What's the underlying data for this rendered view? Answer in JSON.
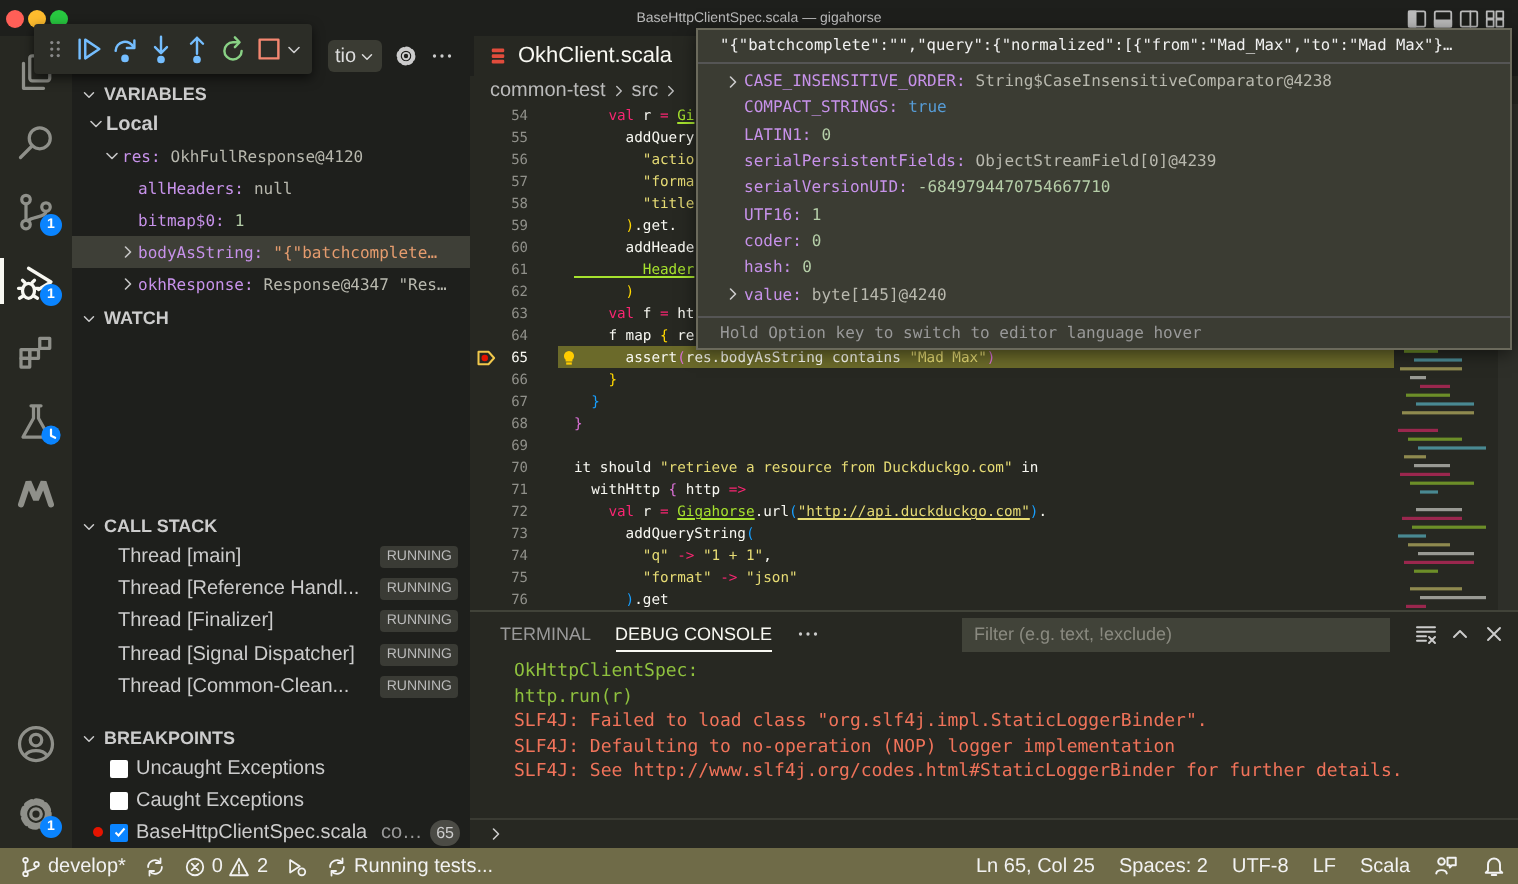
{
  "window": {
    "title": "BaseHttpClientSpec.scala — gigahorse"
  },
  "activity_bar": {
    "items": [
      {
        "kind": "explorer",
        "selected": false
      },
      {
        "kind": "search",
        "selected": false
      },
      {
        "kind": "source_control",
        "selected": false,
        "badge": "1"
      },
      {
        "kind": "run_debug",
        "selected": true,
        "badge": "1"
      },
      {
        "kind": "extensions",
        "selected": false
      },
      {
        "kind": "testing",
        "selected": false
      },
      {
        "kind": "metals",
        "selected": false
      }
    ],
    "bottom": [
      {
        "kind": "account"
      },
      {
        "kind": "settings",
        "badge": "1"
      }
    ]
  },
  "debug_toolbar": {
    "buttons": [
      {
        "kind": "continue"
      },
      {
        "kind": "step_over"
      },
      {
        "kind": "step_into"
      },
      {
        "kind": "step_out"
      },
      {
        "kind": "restart"
      },
      {
        "kind": "stop"
      }
    ]
  },
  "sidebar": {
    "run_config": "tio",
    "sections": [
      {
        "kind": "variables",
        "title": "VARIABLES",
        "expanded": true,
        "children": [
          {
            "label": "Local",
            "expanded": true,
            "selected": false,
            "children": [
              {
                "name": "res:",
                "value": "OkhFullResponse@4120",
                "kind": "object",
                "expanded": true,
                "selected": false,
                "children": [
                  {
                    "name": "allHeaders:",
                    "value": "null",
                    "kind": "null",
                    "selected": false
                  },
                  {
                    "name": "bitmap$0:",
                    "value": "1",
                    "kind": "number",
                    "selected": false
                  },
                  {
                    "name": "bodyAsString:",
                    "value": "\"{\"batchcomplete…",
                    "kind": "string",
                    "expanded": false,
                    "selected": true
                  },
                  {
                    "name": "okhResponse:",
                    "value": "Response@4347 \"Res…",
                    "kind": "object",
                    "expanded": false,
                    "selected": false
                  }
                ]
              }
            ]
          }
        ]
      },
      {
        "kind": "watch",
        "title": "WATCH",
        "expanded": true
      },
      {
        "kind": "call_stack",
        "title": "CALL STACK",
        "expanded": true,
        "threads": [
          {
            "name": "Thread [main]",
            "status": "RUNNING"
          },
          {
            "name": "Thread [Reference Handl...",
            "status": "RUNNING"
          },
          {
            "name": "Thread [Finalizer]",
            "status": "RUNNING"
          },
          {
            "name": "Thread [Signal Dispatcher]",
            "status": "RUNNING"
          },
          {
            "name": "Thread [Common-Clean...",
            "status": "RUNNING"
          }
        ]
      },
      {
        "kind": "breakpoints",
        "title": "BREAKPOINTS",
        "expanded": true,
        "items": [
          {
            "kind": "exception",
            "label": "Uncaught Exceptions",
            "checked": false
          },
          {
            "kind": "exception",
            "label": "Caught Exceptions",
            "checked": false
          },
          {
            "kind": "source",
            "label": "BaseHttpClientSpec.scala",
            "detail": "co…",
            "count": "65",
            "checked": true
          }
        ]
      }
    ]
  },
  "editor": {
    "tabs": [
      {
        "label": "OkhClient.scala",
        "selected": true
      }
    ],
    "breadcrumb": [
      "common-test",
      "src"
    ],
    "lines": [
      {
        "number": "54",
        "current": false,
        "tokens": [
          {
            "text": "    val",
            "kind": "keyword"
          },
          {
            "text": " r ",
            "kind": "plain"
          },
          {
            "text": "= ",
            "kind": "op"
          },
          {
            "text": "Gi",
            "kind": "type"
          }
        ]
      },
      {
        "number": "55",
        "current": false,
        "tokens": [
          {
            "text": "      addQuery",
            "kind": "plain"
          }
        ]
      },
      {
        "number": "56",
        "current": false,
        "tokens": [
          {
            "text": "        \"actio",
            "kind": "string"
          }
        ]
      },
      {
        "number": "57",
        "current": false,
        "tokens": [
          {
            "text": "        \"forma",
            "kind": "string"
          }
        ]
      },
      {
        "number": "58",
        "current": false,
        "tokens": [
          {
            "text": "        \"title",
            "kind": "string"
          }
        ]
      },
      {
        "number": "59",
        "current": false,
        "tokens": [
          {
            "text": "      )",
            "kind": "bracket1"
          },
          {
            "text": ".get.",
            "kind": "plain"
          }
        ]
      },
      {
        "number": "60",
        "current": false,
        "tokens": [
          {
            "text": "      addHeade",
            "kind": "plain"
          }
        ]
      },
      {
        "number": "61",
        "current": false,
        "tokens": [
          {
            "text": "        Header",
            "kind": "type"
          }
        ]
      },
      {
        "number": "62",
        "current": false,
        "tokens": [
          {
            "text": "      )",
            "kind": "bracket1"
          }
        ]
      },
      {
        "number": "63",
        "current": false,
        "tokens": [
          {
            "text": "    val",
            "kind": "keyword"
          },
          {
            "text": " f ",
            "kind": "plain"
          },
          {
            "text": "=",
            "kind": "op"
          },
          {
            "text": " ht",
            "kind": "plain"
          }
        ]
      },
      {
        "number": "64",
        "current": false,
        "tokens": [
          {
            "text": "    f map ",
            "kind": "plain"
          },
          {
            "text": "{",
            "kind": "bracket1"
          },
          {
            "text": " re",
            "kind": "plain"
          }
        ]
      },
      {
        "number": "65",
        "current": true,
        "tokens": [
          {
            "text": "      assert",
            "kind": "plain"
          },
          {
            "text": "(",
            "kind": "bracket2"
          },
          {
            "text": "res.bodyAsString contains ",
            "kind": "plain"
          },
          {
            "text": "\"Mad Max\"",
            "kind": "string"
          },
          {
            "text": ")",
            "kind": "bracket2"
          }
        ]
      },
      {
        "number": "66",
        "current": false,
        "tokens": [
          {
            "text": "    }",
            "kind": "bracket1"
          }
        ]
      },
      {
        "number": "67",
        "current": false,
        "tokens": [
          {
            "text": "  }",
            "kind": "bracket3"
          }
        ]
      },
      {
        "number": "68",
        "current": false,
        "tokens": [
          {
            "text": "}",
            "kind": "bracket2"
          }
        ]
      },
      {
        "number": "69",
        "current": false
      },
      {
        "number": "70",
        "current": false,
        "tokens": [
          {
            "text": "it should ",
            "kind": "plain"
          },
          {
            "text": "\"retrieve a resource from Duckduckgo.com\"",
            "kind": "string"
          },
          {
            "text": " in",
            "kind": "plain"
          }
        ]
      },
      {
        "number": "71",
        "current": false,
        "tokens": [
          {
            "text": "  withHttp ",
            "kind": "plain"
          },
          {
            "text": "{",
            "kind": "bracket2"
          },
          {
            "text": " http ",
            "kind": "plain"
          },
          {
            "text": "=>",
            "kind": "op"
          }
        ]
      },
      {
        "number": "72",
        "current": false,
        "tokens": [
          {
            "text": "    val",
            "kind": "keyword"
          },
          {
            "text": " r ",
            "kind": "plain"
          },
          {
            "text": "= ",
            "kind": "op"
          },
          {
            "text": "Gigahorse",
            "kind": "type"
          },
          {
            "text": ".url",
            "kind": "plain"
          },
          {
            "text": "(",
            "kind": "bracket3"
          },
          {
            "text": "\"http://api.duckduckgo.com\"",
            "kind": "link"
          },
          {
            "text": ")",
            "kind": "bracket3"
          },
          {
            "text": ".",
            "kind": "plain"
          }
        ]
      },
      {
        "number": "73",
        "current": false,
        "tokens": [
          {
            "text": "      addQueryString",
            "kind": "plain"
          },
          {
            "text": "(",
            "kind": "bracket3"
          }
        ]
      },
      {
        "number": "74",
        "current": false,
        "tokens": [
          {
            "text": "        \"q\" ",
            "kind": "string"
          },
          {
            "text": "-> ",
            "kind": "op"
          },
          {
            "text": "\"1 + 1\"",
            "kind": "string"
          },
          {
            "text": ",",
            "kind": "plain"
          }
        ]
      },
      {
        "number": "75",
        "current": false,
        "tokens": [
          {
            "text": "        \"format\" ",
            "kind": "string"
          },
          {
            "text": "-> ",
            "kind": "op"
          },
          {
            "text": "\"json\"",
            "kind": "string"
          }
        ]
      },
      {
        "number": "76",
        "current": false,
        "tokens": [
          {
            "text": "      )",
            "kind": "bracket3"
          },
          {
            "text": ".get",
            "kind": "plain"
          }
        ]
      }
    ]
  },
  "hover": {
    "header": "\"{\"batchcomplete\":\"\",\"query\":{\"normalized\":[{\"from\":\"Mad_Max\",\"to\":\"Mad Max\"}…",
    "rows": [
      {
        "name": "CASE_INSENSITIVE_ORDER:",
        "value": "String$CaseInsensitiveComparator@4238",
        "kind": "object",
        "expanded": false
      },
      {
        "name": "COMPACT_STRINGS:",
        "value": "true",
        "kind": "boolean"
      },
      {
        "name": "LATIN1:",
        "value": "0",
        "kind": "number"
      },
      {
        "name": "serialPersistentFields:",
        "value": "ObjectStreamField[0]@4239",
        "kind": "object"
      },
      {
        "name": "serialVersionUID:",
        "value": "-6849794470754667710",
        "kind": "number"
      },
      {
        "name": "UTF16:",
        "value": "1",
        "kind": "number"
      },
      {
        "name": "coder:",
        "value": "0",
        "kind": "number"
      },
      {
        "name": "hash:",
        "value": "0",
        "kind": "number"
      },
      {
        "name": "value:",
        "value": "byte[145]@4240",
        "kind": "object",
        "expanded": false
      }
    ],
    "footer": "Hold Option key to switch to editor language hover"
  },
  "panel": {
    "tabs": [
      {
        "label": "TERMINAL",
        "selected": false
      },
      {
        "label": "DEBUG CONSOLE",
        "selected": true
      }
    ],
    "filter": {
      "placeholder": "Filter (e.g. text, !exclude)"
    },
    "console": [
      {
        "text": "OkHttpClientSpec:",
        "kind": "stdout"
      },
      {
        "text": "http.run(r)",
        "kind": "stdout"
      },
      {
        "text": "SLF4J: Failed to load class \"org.slf4j.impl.StaticLoggerBinder\".",
        "kind": "stderr"
      },
      {
        "text": "SLF4J: Defaulting to no-operation (NOP) logger implementation",
        "kind": "stderr"
      },
      {
        "text": "SLF4J: See http://www.slf4j.org/codes.html#StaticLoggerBinder for further details.",
        "kind": "stderr"
      }
    ]
  },
  "status_bar": {
    "left": [
      {
        "kind": "branch",
        "text": "develop*"
      },
      {
        "kind": "sync"
      },
      {
        "kind": "problems",
        "errors": "0",
        "warnings": "2"
      },
      {
        "kind": "debug"
      },
      {
        "kind": "progress",
        "text": "Running tests..."
      }
    ],
    "right": [
      {
        "kind": "text",
        "text": "Ln 65, Col 25"
      },
      {
        "kind": "text",
        "text": "Spaces: 2"
      },
      {
        "kind": "text",
        "text": "UTF-8"
      },
      {
        "kind": "text",
        "text": "LF"
      },
      {
        "kind": "text",
        "text": "Scala"
      },
      {
        "kind": "feedback"
      },
      {
        "kind": "bell"
      }
    ]
  }
}
